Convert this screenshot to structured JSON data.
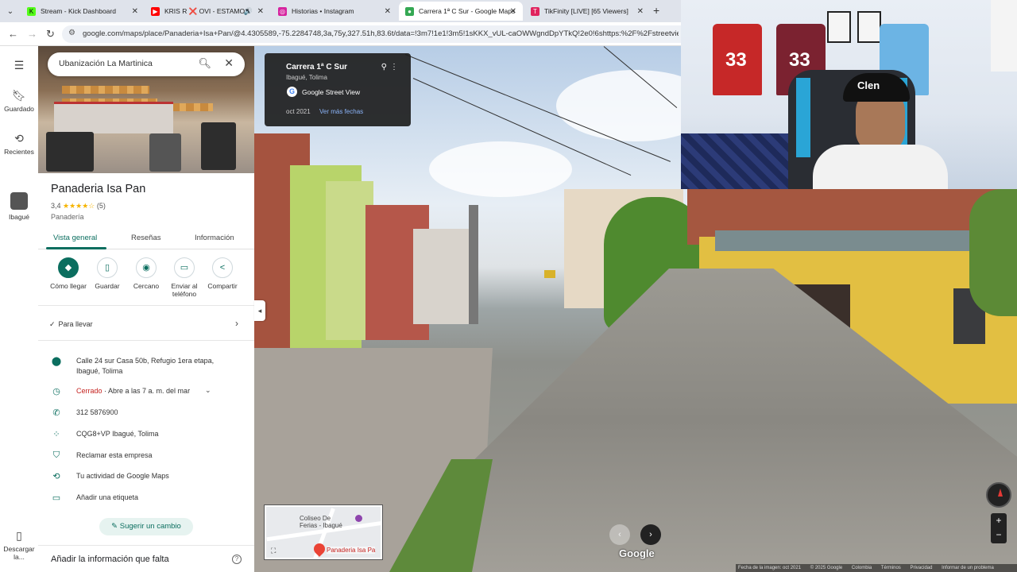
{
  "browser": {
    "tabs": [
      {
        "label": "Stream - Kick Dashboard",
        "favicon_color": "#53fc18",
        "favicon_glyph": "K"
      },
      {
        "label": "KRIS R ❌ OVI - ESTAMOS",
        "favicon_color": "#ff0000",
        "favicon_glyph": "▶"
      },
      {
        "label": "Historias • Instagram",
        "favicon_color": "#d6249f",
        "favicon_glyph": "◎"
      },
      {
        "label": "Carrera 1ª C Sur - Google Maps",
        "favicon_color": "#34a853",
        "favicon_glyph": "●"
      },
      {
        "label": "TikFinity [LIVE] [65 Viewers]",
        "favicon_color": "#e0245e",
        "favicon_glyph": "T"
      }
    ],
    "url": "google.com/maps/place/Panaderia+Isa+Pan/@4.4305589,-75.2284748,3a,75y,327.51h,83.6t/data=!3m7!1e1!3m5!1sKKX_vUL-caOWWgndDpYTkQ!2e0!6shttps:%2F%2Fstreetviewpixels-"
  },
  "rail": {
    "saved": "Guardado",
    "recent": "Recientes",
    "recent_place": "Ibagué",
    "download": "Descargar la..."
  },
  "search": {
    "placeholder": "Ubanización La Martinica"
  },
  "place": {
    "name": "Panaderia Isa Pan",
    "rating": "3,4",
    "stars": "★★★★☆",
    "reviews": "(5)",
    "category": "Panadería",
    "tabs": [
      "Vista general",
      "Reseñas",
      "Información"
    ],
    "actions": [
      {
        "label": "Cómo llegar",
        "icon": "directions-icon",
        "glyph": "◆"
      },
      {
        "label": "Guardar",
        "icon": "bookmark-icon",
        "glyph": "▯"
      },
      {
        "label": "Cercano",
        "icon": "nearby-icon",
        "glyph": "◉"
      },
      {
        "label": "Enviar al teléfono",
        "icon": "phone-send-icon",
        "glyph": "▭"
      },
      {
        "label": "Compartir",
        "icon": "share-icon",
        "glyph": "<"
      }
    ],
    "pickup": "Para llevar",
    "address": "Calle 24 sur Casa 50b, Refugio 1era etapa, Ibagué, Tolima",
    "hours_status": "Cerrado",
    "hours_detail": " · Abre a las 7 a. m. del mar",
    "phone": "312 5876900",
    "plus_code": "CQG8+VP Ibagué, Tolima",
    "claim": "Reclamar esta empresa",
    "activity": "Tu actividad de Google Maps",
    "label": "Añadir una etiqueta",
    "suggest": "Sugerir un cambio",
    "missing": "Añadir la información que falta"
  },
  "streetview": {
    "street": "Carrera 1ª C Sur",
    "city": "Ibagué, Tolima",
    "source": "Google Street View",
    "date": "oct 2021",
    "more_dates": "Ver más fechas",
    "minimap_poi": "Coliseo De Ferias - Ibagué",
    "minimap_place": "Panaderia Isa Pa",
    "logo": "Google",
    "footer": [
      "Fecha de la imagen: oct 2021",
      "© 2025 Google",
      "Colombia",
      "Términos",
      "Privacidad",
      "Informar de un problema"
    ]
  },
  "webcam": {
    "cap_text": "Clen",
    "jersey_numbers": [
      "33",
      "33"
    ]
  }
}
